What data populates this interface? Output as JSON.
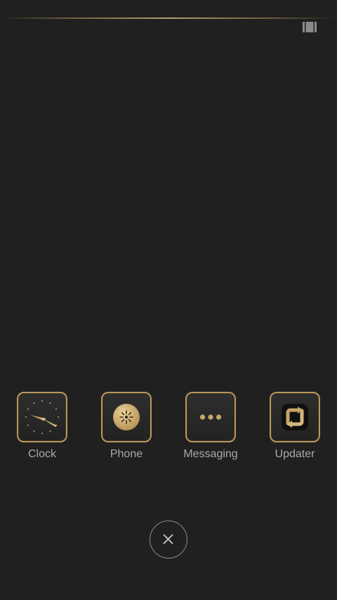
{
  "colors": {
    "background": "#202020",
    "accent_gold": "#b9975b",
    "label": "#a9a9a9"
  },
  "status_bar": {
    "multi_window_icon": "multi-window-icon"
  },
  "dock": {
    "apps": [
      {
        "label": "Clock",
        "icon": "clock-icon"
      },
      {
        "label": "Phone",
        "icon": "phone-icon"
      },
      {
        "label": "Messaging",
        "icon": "messaging-icon"
      },
      {
        "label": "Updater",
        "icon": "updater-icon"
      }
    ]
  },
  "close_button": {
    "icon": "close-icon"
  }
}
